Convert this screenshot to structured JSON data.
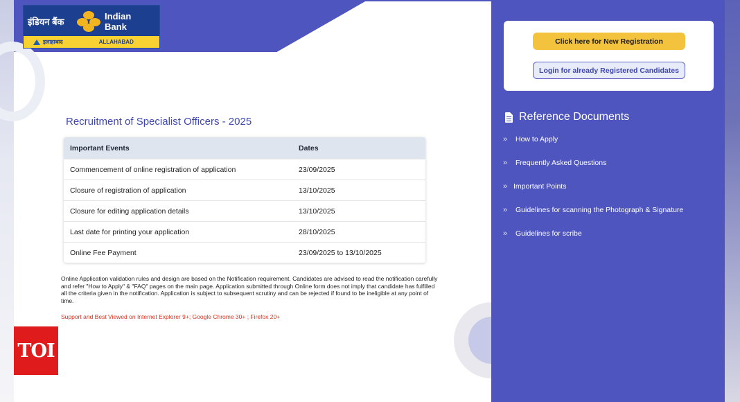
{
  "logo": {
    "hindi_name": "इंडियन बैंक",
    "english_name": "Indian Bank",
    "hindi_subtitle": "इलाहाबाद",
    "english_subtitle": "ALLAHABAD"
  },
  "main": {
    "title": "Recruitment of Specialist Officers - 2025",
    "table": {
      "headers": [
        "Important Events",
        "Dates"
      ],
      "rows": [
        {
          "event": "Commencement of online registration of application",
          "date": "23/09/2025"
        },
        {
          "event": "Closure of registration of application",
          "date": "13/10/2025"
        },
        {
          "event": "Closure for editing application details",
          "date": "13/10/2025"
        },
        {
          "event": "Last date for printing your application",
          "date": "28/10/2025"
        },
        {
          "event": "Online Fee Payment",
          "date": "23/09/2025 to 13/10/2025"
        }
      ]
    },
    "note": "Online Application validation rules and design are based on the Notification requirement. Candidates are advised to read the notification carefully and refer \"How to Apply\" & \"FAQ\" pages on the main page. Application submitted through Online form does not imply that candidate has fulfilled all the criteria given in the notification. Application is subject to subsequent scrutiny and can be rejected if found to be ineligible at any point of time.",
    "support": "Support and Best Viewed on Internet Explorer 9+; Google Chrome 30+ ; Firefox 20+"
  },
  "sidebar": {
    "new_registration_label": "Click here for New Registration",
    "login_label": "Login for already Registered Candidates",
    "reference_heading": "Reference Documents",
    "items": [
      {
        "label": "How to Apply"
      },
      {
        "label": "Frequently Asked Questions"
      },
      {
        "label": "Important Points"
      },
      {
        "label": "Guidelines for scanning the Photograph & Signature"
      },
      {
        "label": "Guidelines for scribe"
      }
    ]
  },
  "watermark": {
    "label": "TOI"
  },
  "colors": {
    "primary": "#4f55bf",
    "accent_yellow": "#f4c33d",
    "title_blue": "#3f47b2",
    "support_red": "#d8321f",
    "toi_red": "#e01b1b"
  }
}
